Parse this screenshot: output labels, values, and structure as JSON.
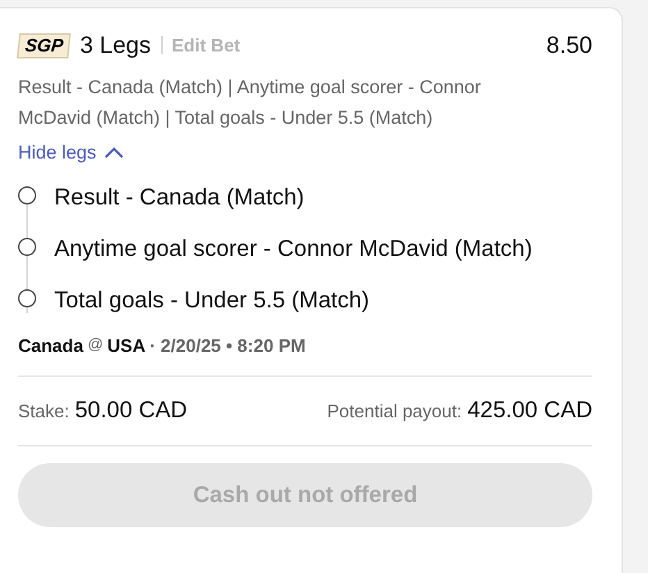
{
  "bet": {
    "badge": "SGP",
    "title": "3 Legs",
    "edit_link": "Edit Bet",
    "odds": "8.50",
    "summary": "Result - Canada (Match) | Anytime goal scorer - Connor McDavid (Match) | Total goals - Under 5.5 (Match)",
    "toggle": {
      "label": "Hide legs",
      "expanded": true
    },
    "legs": [
      {
        "label": "Result - Canada (Match)"
      },
      {
        "label": "Anytime goal scorer - Connor McDavid (Match)"
      },
      {
        "label": "Total goals - Under 5.5 (Match)"
      }
    ],
    "event": {
      "home": "Canada",
      "at": "@",
      "away": "USA",
      "datetime": "· 2/20/25 • 8:20 PM"
    },
    "stake": {
      "label": "Stake:",
      "value": "50.00 CAD"
    },
    "payout": {
      "label": "Potential payout:",
      "value": "425.00 CAD"
    },
    "cashout": {
      "label": "Cash out not offered",
      "disabled": true
    }
  }
}
